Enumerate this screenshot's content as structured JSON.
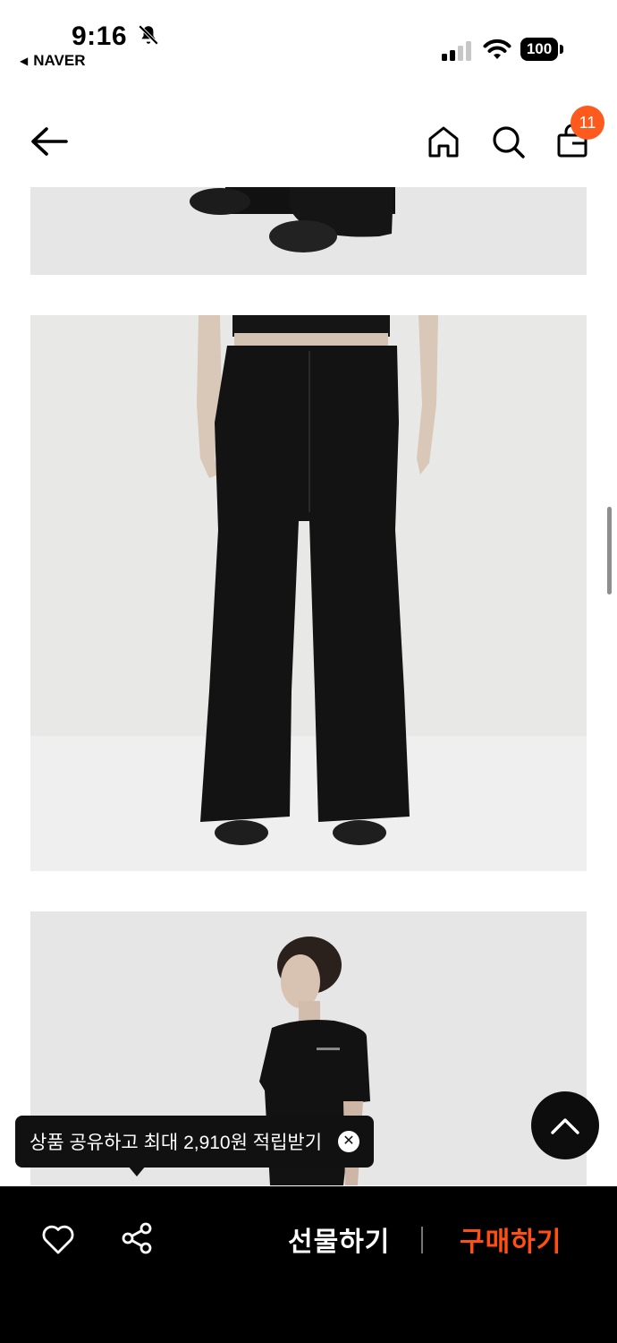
{
  "status_bar": {
    "time": "9:16",
    "back_app": "NAVER",
    "battery": "100",
    "icons": [
      "bell-off-icon",
      "signal-icon",
      "wifi-icon",
      "battery-icon"
    ]
  },
  "top_nav": {
    "icons": [
      "back-arrow-icon",
      "home-icon",
      "search-icon",
      "shopping-bag-icon"
    ],
    "cart_count": "11",
    "badge_color": "#ff5a1e"
  },
  "tooltip": {
    "text": "상품 공유하고 최대 2,910원 적립받기",
    "close_symbol": "✕"
  },
  "bottom_bar": {
    "wishlist_icon": "heart-icon",
    "share_icon": "share-icon",
    "gift_label": "선물하기",
    "buy_label": "구매하기",
    "buy_color": "#ff4f12"
  },
  "scroll_top_icon": "chevron-up-icon"
}
